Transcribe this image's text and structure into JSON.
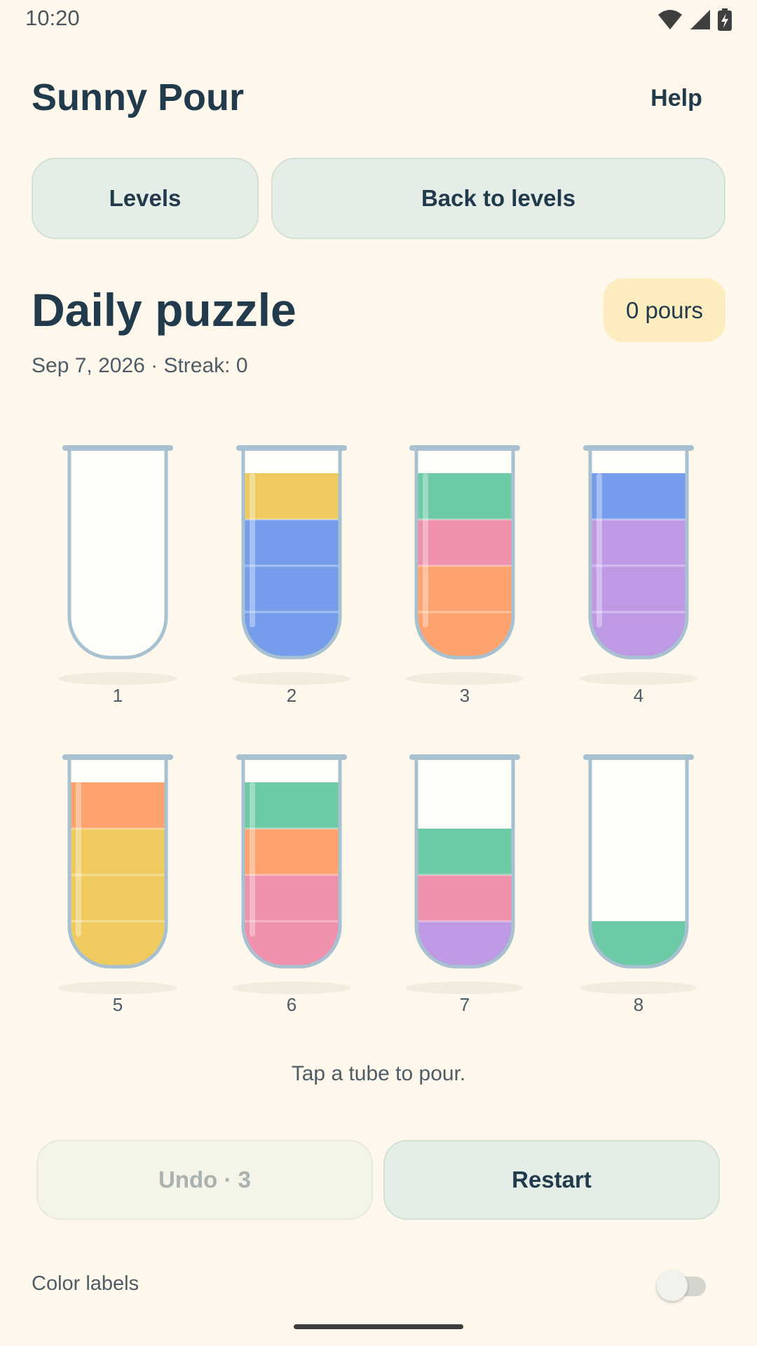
{
  "status_bar": {
    "time": "10:20",
    "icons": [
      "wifi-icon",
      "signal-icon",
      "battery-charging-icon"
    ]
  },
  "header": {
    "title": "Sunny Pour",
    "help_label": "Help"
  },
  "nav": {
    "levels_label": "Levels",
    "back_label": "Back to levels"
  },
  "puzzle": {
    "title": "Daily puzzle",
    "pours_label": "0 pours",
    "subtitle": "Sep 7, 2026 · Streak: 0"
  },
  "colors": {
    "yellow": "#efcb5f",
    "blue": "#759deb",
    "green": "#6ccaa6",
    "pink": "#ef91ad",
    "orange": "#fea36e",
    "purple": "#be9ae4",
    "background": "#fef7ec",
    "tube_outline": "#a7c1d0"
  },
  "tube_capacity": 4,
  "tubes": [
    {
      "label": "1",
      "layers": []
    },
    {
      "label": "2",
      "layers": [
        "blue",
        "blue",
        "blue",
        "yellow"
      ]
    },
    {
      "label": "3",
      "layers": [
        "orange",
        "orange",
        "pink",
        "green"
      ]
    },
    {
      "label": "4",
      "layers": [
        "purple",
        "purple",
        "purple",
        "blue"
      ]
    },
    {
      "label": "5",
      "layers": [
        "yellow",
        "yellow",
        "yellow",
        "orange"
      ]
    },
    {
      "label": "6",
      "layers": [
        "pink",
        "pink",
        "orange",
        "green"
      ]
    },
    {
      "label": "7",
      "layers": [
        "purple",
        "pink",
        "green"
      ]
    },
    {
      "label": "8",
      "layers": [
        "green"
      ]
    }
  ],
  "hint": "Tap a tube to pour.",
  "controls": {
    "undo_label": "Undo · 3",
    "restart_label": "Restart"
  },
  "settings": {
    "color_labels_label": "Color labels",
    "color_labels_on": false
  }
}
